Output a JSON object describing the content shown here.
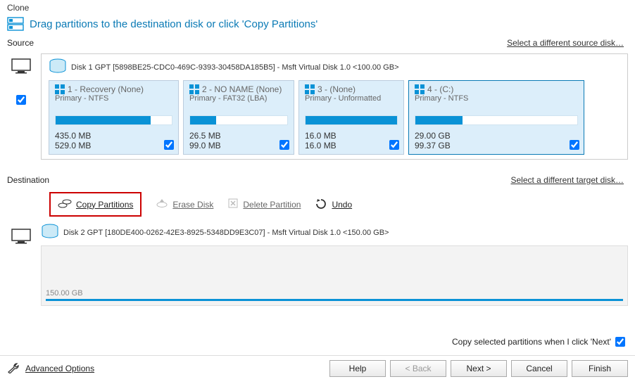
{
  "title": "Clone",
  "instruction": "Drag partitions to the destination disk or click 'Copy Partitions'",
  "source": {
    "label": "Source",
    "link": "Select a different source disk…",
    "disk": {
      "header": "Disk 1 GPT [5898BE25-CDC0-469C-9393-30458DA185B5] - Msft     Virtual Disk     1.0  <100.00 GB>",
      "partitions": [
        {
          "title_num": "1",
          "title_name": " - Recovery (None)",
          "sub": "Primary - NTFS",
          "used": "435.0 MB",
          "total": "529.0 MB",
          "fill": 82
        },
        {
          "title_num": "2",
          "title_name": " - NO NAME (None)",
          "sub": "Primary - FAT32 (LBA)",
          "used": "26.5 MB",
          "total": "99.0 MB",
          "fill": 27
        },
        {
          "title_num": "3",
          "title_name": " -  (None)",
          "sub": "Primary - Unformatted",
          "used": "16.0 MB",
          "total": "16.0 MB",
          "fill": 100
        },
        {
          "title_num": "4",
          "title_name": " -  (C:)",
          "sub": "Primary - NTFS",
          "used": "29.00 GB",
          "total": "99.37 GB",
          "fill": 29
        }
      ]
    }
  },
  "destination": {
    "label": "Destination",
    "link": "Select a different target disk…",
    "toolbar": {
      "copy": "Copy Partitions",
      "erase": "Erase Disk",
      "delete": "Delete Partition",
      "undo": "Undo"
    },
    "disk": {
      "header": "Disk 2 GPT [180DE400-0262-42E3-8925-5348DD9E3C07] - Msft     Virtual Disk     1.0  <150.00 GB>",
      "free_label": "150.00 GB"
    }
  },
  "footer": {
    "copy_when_next": "Copy selected partitions when I click 'Next'",
    "advanced": "Advanced Options",
    "buttons": {
      "help": "Help",
      "back": "< Back",
      "next": "Next >",
      "cancel": "Cancel",
      "finish": "Finish"
    }
  }
}
